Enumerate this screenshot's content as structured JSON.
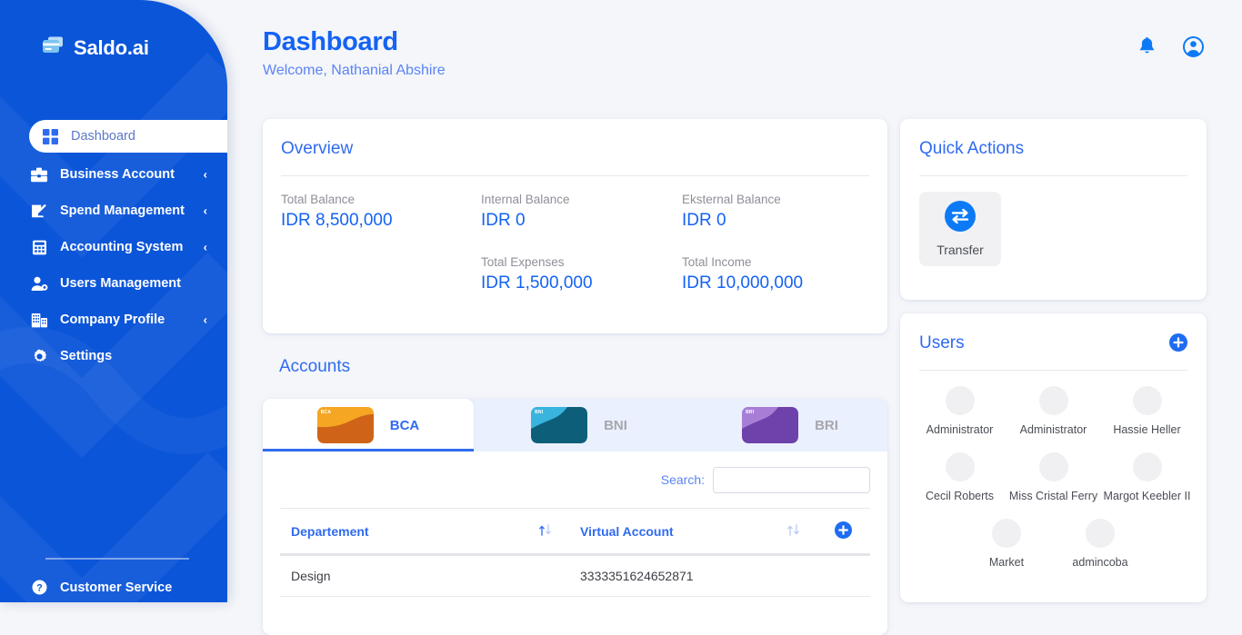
{
  "brand": {
    "name": "Saldo.ai",
    "logo_icon": "wallet-cards-icon"
  },
  "sidebar": {
    "items": [
      {
        "label": "Dashboard",
        "icon": "grid-icon",
        "active": true,
        "expandable": false
      },
      {
        "label": "Business Account",
        "icon": "briefcase-icon",
        "active": false,
        "expandable": true
      },
      {
        "label": "Spend Management",
        "icon": "edit-document-icon",
        "active": false,
        "expandable": true
      },
      {
        "label": "Accounting System",
        "icon": "calculator-icon",
        "active": false,
        "expandable": true
      },
      {
        "label": "Users Management",
        "icon": "user-gear-icon",
        "active": false,
        "expandable": false
      },
      {
        "label": "Company Profile",
        "icon": "building-icon",
        "active": false,
        "expandable": true
      },
      {
        "label": "Settings",
        "icon": "gear-icon",
        "active": false,
        "expandable": false
      }
    ],
    "footer": {
      "label": "Customer Service",
      "icon": "question-circle-icon"
    },
    "chevron_glyph": "‹"
  },
  "header": {
    "title": "Dashboard",
    "welcome": "Welcome, Nathanial Abshire",
    "notification_icon": "bell-icon",
    "account_icon": "user-circle-icon"
  },
  "overview": {
    "title": "Overview",
    "stats": [
      {
        "label": "Total Balance",
        "value": "IDR 8,500,000"
      },
      {
        "label": "Internal Balance",
        "value": "IDR 0"
      },
      {
        "label": "Eksternal Balance",
        "value": "IDR 0"
      },
      {
        "label": "Total Expenses",
        "value": "IDR 1,500,000"
      },
      {
        "label": "Total Income",
        "value": "IDR 10,000,000"
      }
    ]
  },
  "accounts": {
    "title": "Accounts",
    "tabs": [
      {
        "label": "BCA",
        "active": true,
        "card_icon": "bca-card-icon",
        "card_logo": "BCA"
      },
      {
        "label": "BNI",
        "active": false,
        "card_icon": "bni-card-icon",
        "card_logo": "BNI"
      },
      {
        "label": "BRI",
        "active": false,
        "card_icon": "bri-card-icon",
        "card_logo": "BRI"
      }
    ],
    "search": {
      "label": "Search:",
      "value": "",
      "placeholder": ""
    },
    "table": {
      "columns": [
        "Departement",
        "Virtual Account"
      ],
      "rows": [
        {
          "departement": "Design",
          "virtual_account": "3333351624652871"
        }
      ],
      "sort_icon": "sort-arrows-icon",
      "add_icon": "plus-circle-icon"
    }
  },
  "quick_actions": {
    "title": "Quick Actions",
    "actions": [
      {
        "label": "Transfer",
        "icon": "transfer-arrows-icon"
      }
    ]
  },
  "users": {
    "title": "Users",
    "add_icon": "plus-circle-icon",
    "list": [
      {
        "name": "Administrator"
      },
      {
        "name": "Administrator"
      },
      {
        "name": "Hassie Heller"
      },
      {
        "name": "Cecil Roberts"
      },
      {
        "name": "Miss Cristal Ferry"
      },
      {
        "name": "Margot Keebler II"
      },
      {
        "name": "Market"
      },
      {
        "name": "admincoba"
      }
    ]
  },
  "colors": {
    "sidebar_blue": "#0b55d9",
    "accent_blue": "#1463f3",
    "muted_text": "#8e9099",
    "page_bg": "#f4f6fa",
    "bca_orange": "#cf6318",
    "bni_teal": "#0d5f79",
    "bri_purple": "#6d42ab"
  }
}
